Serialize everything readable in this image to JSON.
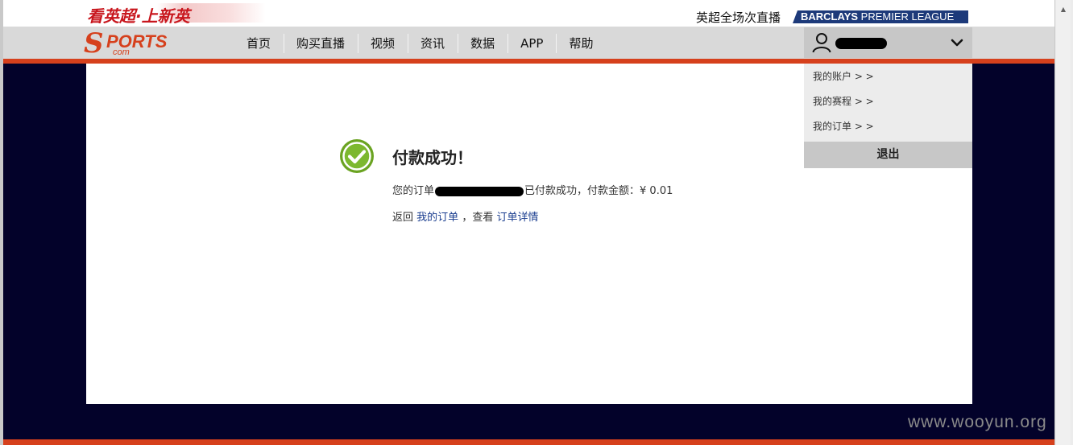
{
  "top": {
    "promo": "看英超·上新英",
    "live": "英超全场次直播",
    "barclays_bold": "BARCLAYS",
    "barclays_light": "PREMIER LEAGUE"
  },
  "logo": {
    "main": "PORTS",
    "s": "S",
    "com": "com"
  },
  "nav": {
    "items": [
      "首页",
      "购买直播",
      "视频",
      "资讯",
      "数据",
      "APP",
      "帮助"
    ]
  },
  "user": {
    "menu": [
      "我的账户 > >",
      "我的赛程 > >",
      "我的订单 > >"
    ],
    "logout": "退出"
  },
  "result": {
    "title": "付款成功！",
    "order_prefix": "您的订单",
    "order_suffix": "已付款成功，付款金额：¥ 0.01",
    "return_prefix": "返回",
    "my_orders": "我的订单",
    "view_text": "，查看",
    "order_detail": "订单详情"
  },
  "watermark": "www.wooyun.org",
  "colors": {
    "brand_red": "#d6401c",
    "navy": "#03022a",
    "success_green": "#6aa321"
  }
}
